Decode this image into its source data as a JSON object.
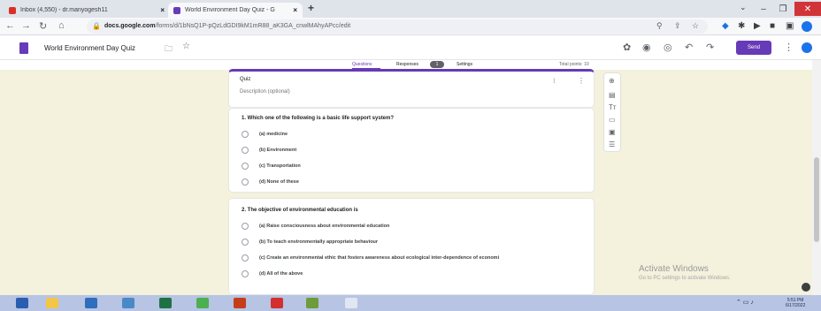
{
  "browser": {
    "tabs": [
      {
        "title": "Inbox (4,550) - dr.manyogesh11",
        "favicon": "gmail-icon",
        "active": false
      },
      {
        "title": "World Environment Day Quiz - G",
        "favicon": "google-forms-icon",
        "active": true
      }
    ],
    "url_domain": "docs.google.com",
    "url_path": "/forms/d/1bNsQ1P-pQzLdGDI9kM1mR88_aK3GA_cnwlMAhyAPcc/edit"
  },
  "forms_header": {
    "doc_title": "World Environment Day Quiz",
    "send_label": "Send"
  },
  "form_tabs": {
    "questions": "Questions",
    "responses": "Responses",
    "responses_count": "1",
    "settings": "Settings",
    "total_points": "Total points: 10"
  },
  "title_card": {
    "name": "Quiz",
    "description_placeholder": "Description (optional)"
  },
  "questions": [
    {
      "text": "1. Which one of the following is a basic life support system?",
      "options": [
        "(a) medicine",
        "(b) Environment",
        "(c) Transportation",
        "(d) None of these"
      ]
    },
    {
      "text": "2. The objective of environmental education is",
      "options": [
        "(a) Raise consciousness about environmental education",
        "(b) To teach environmentally appropriate behaviour",
        "(c) Create an environmental ethic that fosters awareness about ecological inter-dependence of economi",
        "(d) All of the above"
      ]
    }
  ],
  "watermark": {
    "title": "Activate Windows",
    "subtitle": "Go to PC settings to activate Windows."
  },
  "taskbar": {
    "time": "5:51 PM",
    "date": "6/17/2022"
  },
  "colors": {
    "forms_purple": "#673ab7",
    "page_background": "#f4f1dc",
    "taskbar": "#b7c4e3"
  }
}
